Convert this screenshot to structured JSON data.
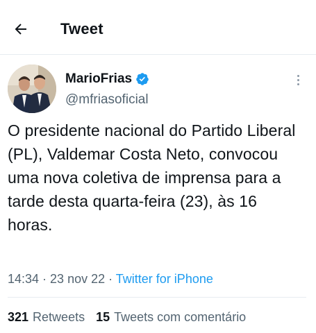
{
  "header": {
    "title": "Tweet",
    "back_icon": "arrow-left-icon"
  },
  "author": {
    "name": "MarioFrias",
    "handle": "@mfriasoficial",
    "verified_color": "#1d9bf0",
    "more_icon": "more-vertical-icon"
  },
  "tweet": {
    "text": "O presidente nacional do Partido Liberal (PL), Valdemar Costa Neto, convocou uma nova coletiva de imprensa para a tarde desta quarta-feira (23), às 16 horas."
  },
  "meta": {
    "time": "14:34",
    "separator1": " · ",
    "date": "23 nov 22",
    "separator2": " · ",
    "source": "Twitter for iPhone"
  },
  "stats": {
    "retweets_count": "321",
    "retweets_label": "Retweets",
    "quotes_count": "15",
    "quotes_label": "Tweets com comentário"
  },
  "colors": {
    "accent": "#1d9bf0",
    "text_primary": "#0f1419",
    "text_secondary": "#536471",
    "divider": "#e6ecf0"
  }
}
